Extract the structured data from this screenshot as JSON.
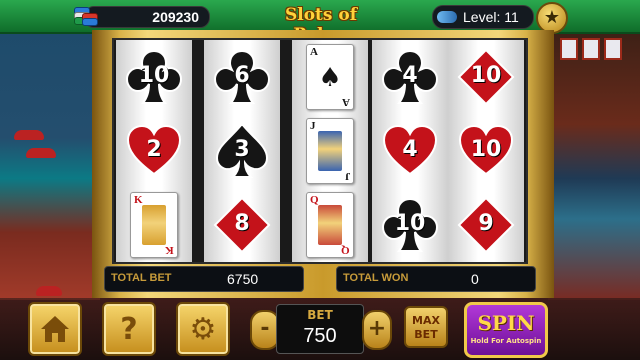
{
  "header": {
    "coins": "209230",
    "title": "Slots of Poker",
    "level_label": "Level: 11",
    "star_icon": "star-icon",
    "chips_icon": "poker-chips-icon"
  },
  "reels": [
    [
      {
        "kind": "suit",
        "suit": "club",
        "label": "10"
      },
      {
        "kind": "suit",
        "suit": "heart",
        "label": "2"
      },
      {
        "kind": "card",
        "rank": "K",
        "suit": "diamond"
      }
    ],
    [
      {
        "kind": "suit",
        "suit": "club",
        "label": "6"
      },
      {
        "kind": "suit",
        "suit": "spade",
        "label": "3"
      },
      {
        "kind": "suit",
        "suit": "diamond",
        "label": "8"
      }
    ],
    [
      {
        "kind": "card",
        "rank": "A",
        "suit": "spade"
      },
      {
        "kind": "card",
        "rank": "J",
        "suit": "spade"
      },
      {
        "kind": "card",
        "rank": "Q",
        "suit": "heart"
      }
    ],
    [
      {
        "kind": "suit",
        "suit": "club",
        "label": "4"
      },
      {
        "kind": "suit",
        "suit": "heart",
        "label": "4"
      },
      {
        "kind": "suit",
        "suit": "club",
        "label": "10"
      }
    ],
    [
      {
        "kind": "suit",
        "suit": "diamond",
        "label": "10"
      },
      {
        "kind": "suit",
        "suit": "heart",
        "label": "10"
      },
      {
        "kind": "suit",
        "suit": "diamond",
        "label": "9"
      }
    ]
  ],
  "totals": {
    "total_bet_label": "TOTAL BET",
    "total_bet_value": "6750",
    "total_won_label": "TOTAL WON",
    "total_won_value": "0"
  },
  "controls": {
    "home_icon": "home-icon",
    "help_glyph": "?",
    "settings_icon": "gear-icon",
    "minus": "-",
    "plus": "+",
    "bet_label": "BET",
    "bet_value": "750",
    "max_bet_line1": "MAX",
    "max_bet_line2": "BET",
    "spin_label": "SPIN",
    "spin_sub": "Hold For Autospin"
  },
  "colors": {
    "suit_red": "#c4121a",
    "suit_black": "#151515",
    "accent_gold": "#f0c94a",
    "spin_purple": "#8b1fb5",
    "topbar_green": "#1f8f3f"
  }
}
